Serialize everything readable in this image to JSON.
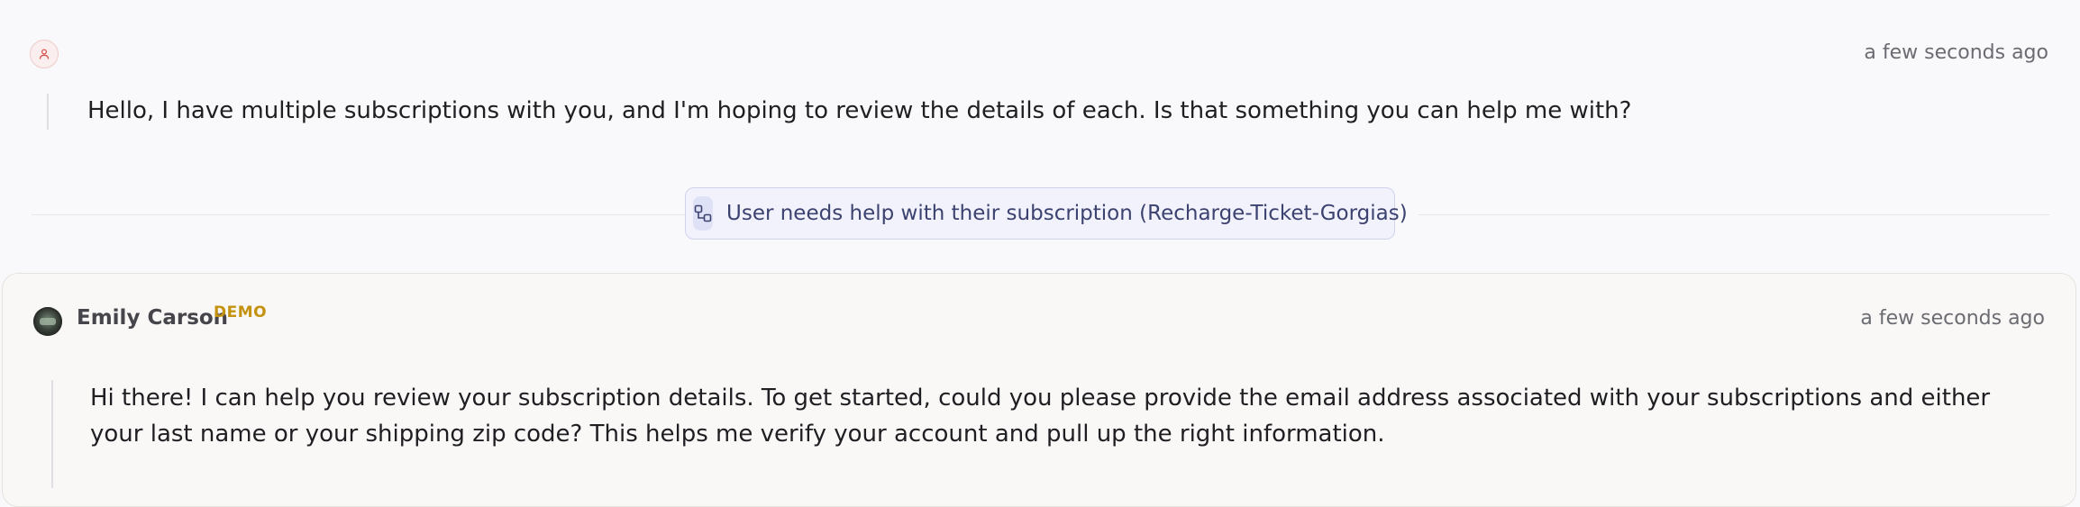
{
  "user_message": {
    "avatar_icon": "user-icon",
    "timestamp": "a few seconds ago",
    "text": "Hello, I have multiple subscriptions with you, and I'm hoping to review the details of each. Is that something you can help me with?"
  },
  "intent_divider": {
    "icon": "workflow-icon",
    "label": "User needs help with their subscription (Recharge-Ticket-Gorgias)"
  },
  "agent_message": {
    "name": "Emily Carson",
    "badge": "DEMO",
    "timestamp": "a few seconds ago",
    "text": "Hi there! I can help you review your subscription details. To get started, could you please provide the email address associated with your subscriptions and either your last name or your shipping zip code? This helps me verify your account and pull up the right information."
  },
  "colors": {
    "background": "#f9f9fb",
    "intent_chip_bg": "#f1f2fb",
    "intent_chip_border": "#cfd3ee",
    "demo_badge": "#c4920f",
    "user_avatar_accent": "#d9534f"
  }
}
